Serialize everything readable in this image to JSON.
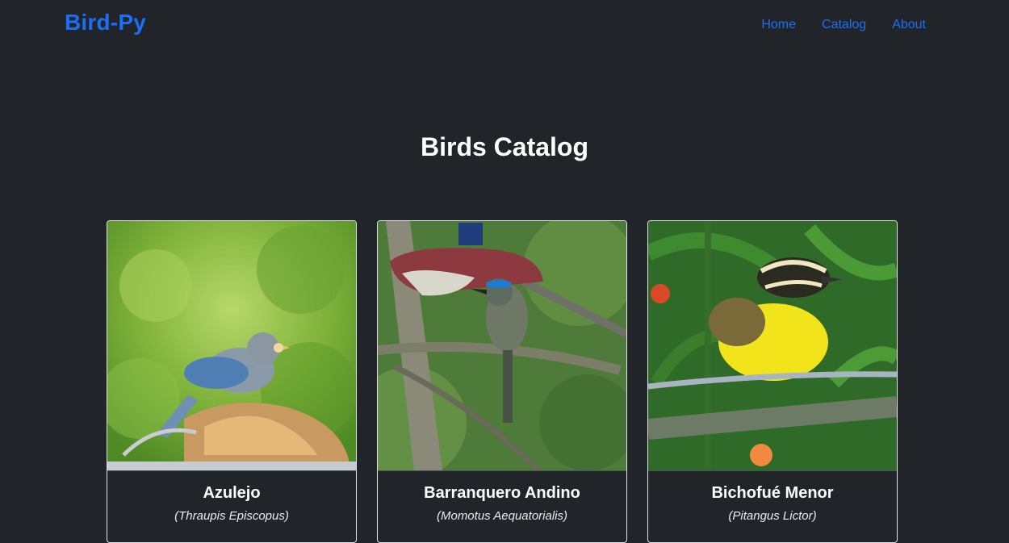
{
  "nav": {
    "brand": "Bird-Py",
    "links": [
      "Home",
      "Catalog",
      "About"
    ]
  },
  "page": {
    "title": "Birds Catalog"
  },
  "birds": [
    {
      "name": "Azulejo",
      "scientific": "(Thraupis Episcopus)"
    },
    {
      "name": "Barranquero Andino",
      "scientific": "(Momotus Aequatorialis)"
    },
    {
      "name": "Bichofué Menor",
      "scientific": "(Pitangus Lictor)"
    }
  ],
  "colors": {
    "background": "#212529",
    "link": "#1d6ef6",
    "card_border": "#dee2e6"
  }
}
